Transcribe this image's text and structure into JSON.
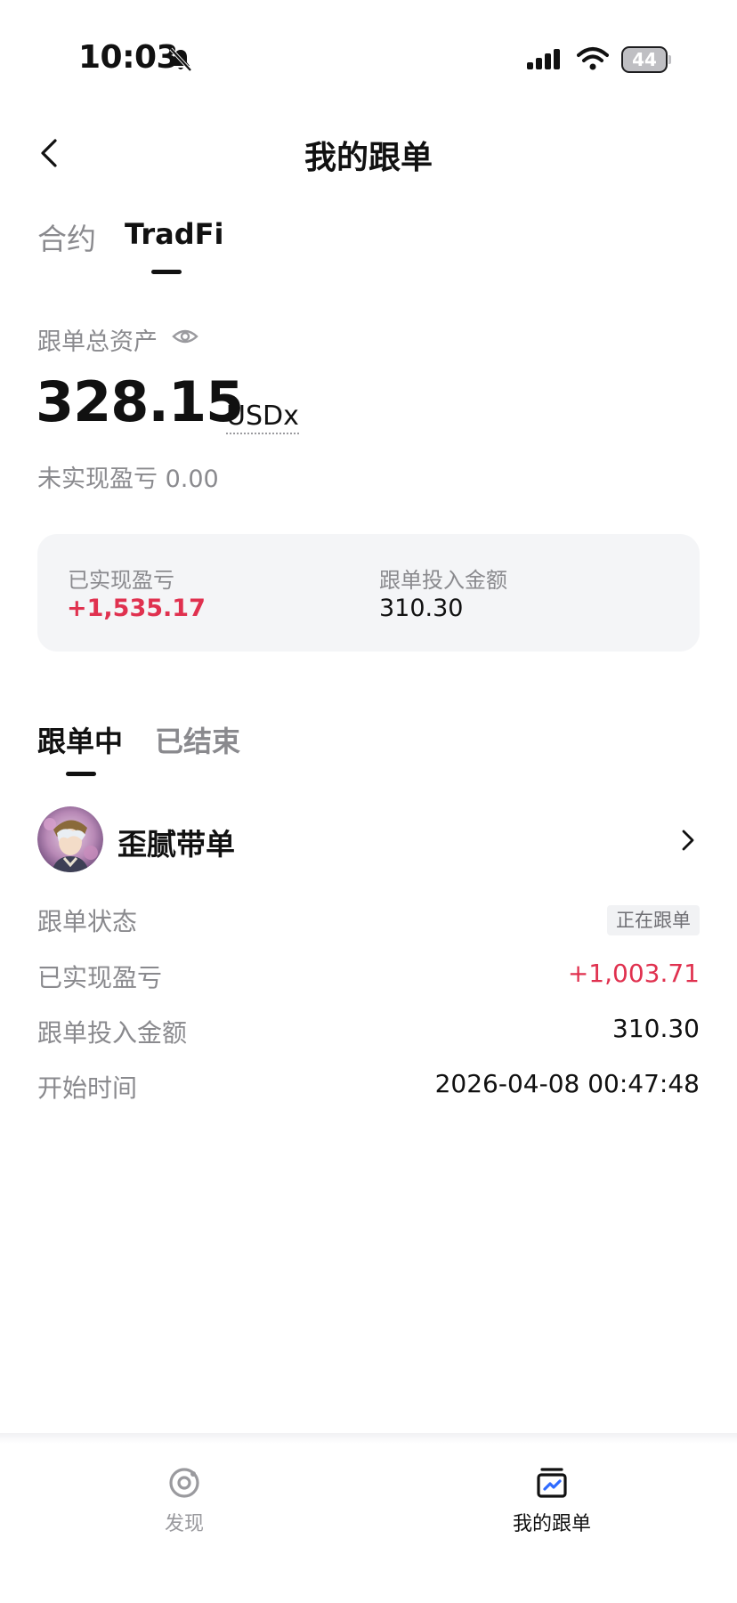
{
  "status_bar": {
    "time": "10:03",
    "battery": "44"
  },
  "header": {
    "title": "我的跟单"
  },
  "top_tabs": [
    {
      "label": "合约"
    },
    {
      "label": "TradFi"
    }
  ],
  "summary": {
    "total_label": "跟单总资产",
    "total_value": "328.15",
    "unit": "USDx",
    "unrealized_text": "未实现盈亏 0.00"
  },
  "stats": {
    "realized_label": "已实现盈亏",
    "realized_value": "+1,535.17",
    "invest_label": "跟单投入金额",
    "invest_value": "310.30"
  },
  "sub_tabs": [
    {
      "label": "跟单中"
    },
    {
      "label": "已结束"
    }
  ],
  "trader": {
    "name": "歪腻带单",
    "rows": {
      "status_label": "跟单状态",
      "status_value": "正在跟单",
      "realized_label": "已实现盈亏",
      "realized_value": "+1,003.71",
      "invest_label": "跟单投入金额",
      "invest_value": "310.30",
      "start_label": "开始时间",
      "start_value": "2026-04-08 00:47:48"
    }
  },
  "bottom_nav": [
    {
      "label": "发现",
      "icon": "discover-icon"
    },
    {
      "label": "我的跟单",
      "icon": "my-copy-trading-icon"
    }
  ],
  "colors": {
    "accent_red": "#e0314f",
    "muted": "#8a8a8e",
    "card_bg": "#f4f5f7"
  }
}
